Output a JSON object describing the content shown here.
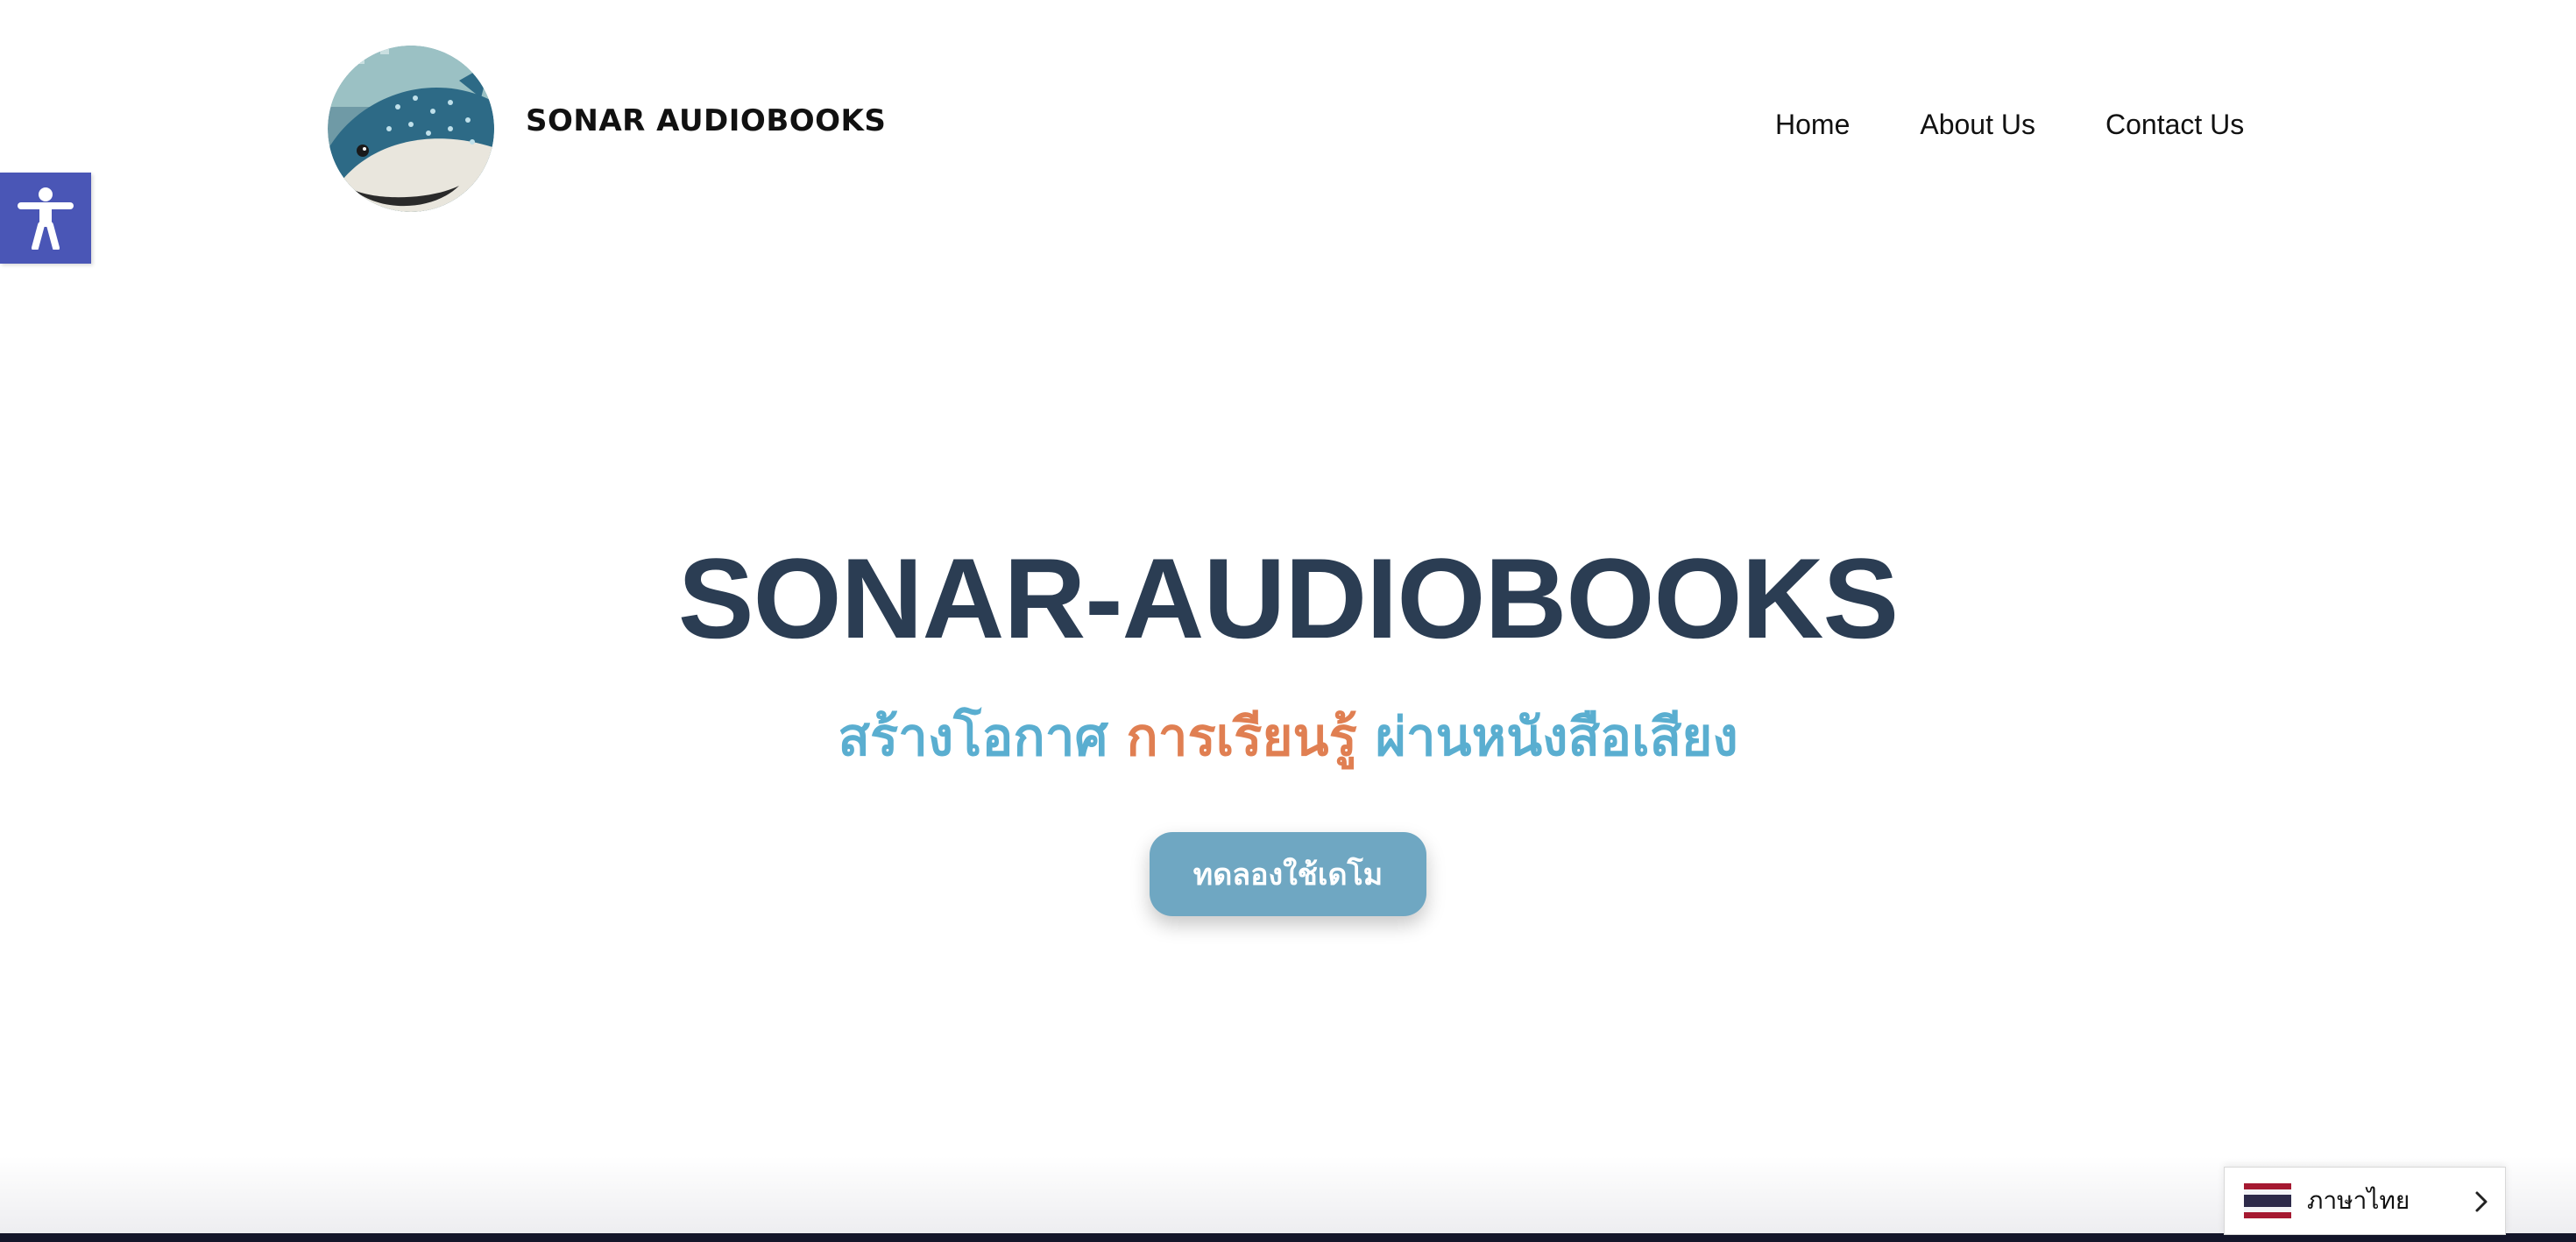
{
  "header": {
    "brand": "SONAR AUDIOBOOKS",
    "logo_icon": "whale-shark-logo-icon",
    "nav": [
      {
        "label": "Home"
      },
      {
        "label": "About Us"
      },
      {
        "label": "Contact Us"
      }
    ]
  },
  "accessibility": {
    "icon": "accessibility-person-icon",
    "color": "#4a56b6"
  },
  "hero": {
    "title": "SONAR-AUDIOBOOKS",
    "subtitle_part1": "สร้างโอกาศ",
    "subtitle_part2": "การเรียนรู้",
    "subtitle_part3": "ผ่านหนังสือเสียง",
    "cta_label": "ทดลองใช้เดโม"
  },
  "language": {
    "label": "ภาษาไทย",
    "flag_icon": "thai-flag-icon",
    "chevron_icon": "chevron-right-icon"
  },
  "colors": {
    "title": "#2b3d53",
    "subtitle_blue": "#5aaed0",
    "subtitle_orange": "#e07f52",
    "cta_bg": "#6fa7c2"
  }
}
